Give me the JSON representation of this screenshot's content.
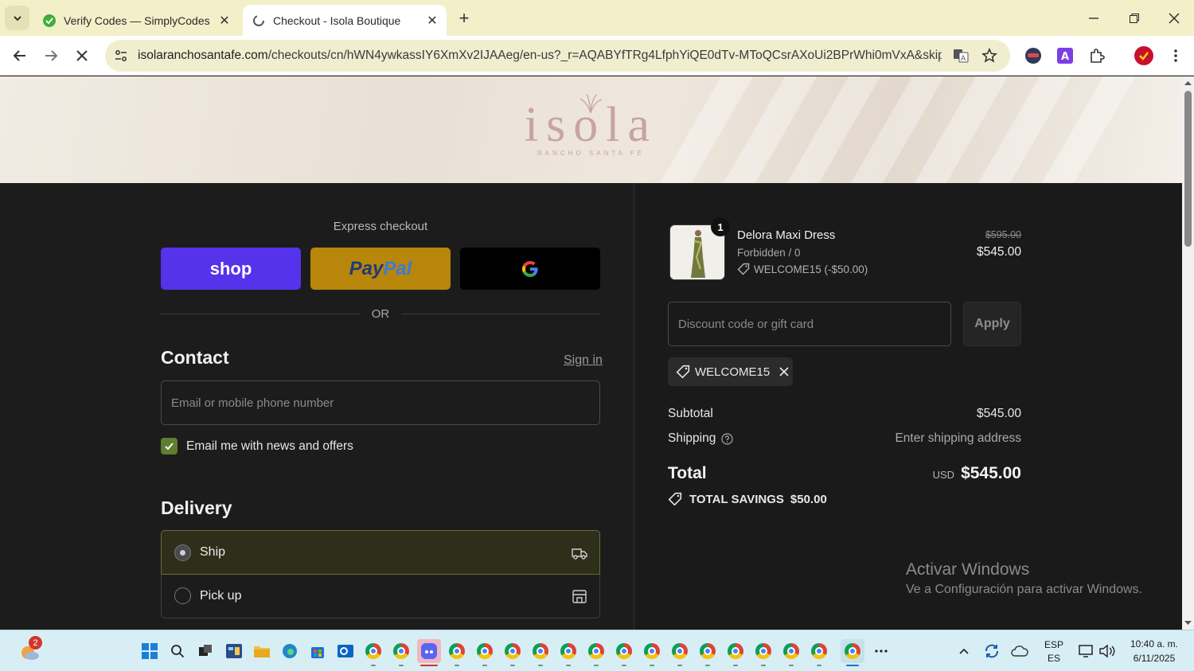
{
  "browser": {
    "tabs": [
      {
        "title": "Verify Codes — SimplyCodes",
        "active": false
      },
      {
        "title": "Checkout - Isola Boutique",
        "active": true
      }
    ],
    "url_host": "isolaranchosantafe.com",
    "url_path": "/checkouts/cn/hWN4ywkassIY6XmXv2IJAAeg/en-us?_r=AQABYfTRg4LfphYiQE0dTv-MToQCsrAXoUi2BPrWhi0mVxA&skip_sh..."
  },
  "banner": {
    "logo_word": "isola",
    "logo_sub": "RANCHO SANTA FE"
  },
  "checkout": {
    "express_title": "Express checkout",
    "shop_label": "shop",
    "paypal_pay": "Pay",
    "paypal_pal": "Pal",
    "or_label": "OR",
    "contact_heading": "Contact",
    "signin_label": "Sign in",
    "email_placeholder": "Email or mobile phone number",
    "news_label": "Email me with news and offers",
    "delivery_heading": "Delivery",
    "ship_label": "Ship",
    "pickup_label": "Pick up"
  },
  "summary": {
    "item": {
      "quantity": "1",
      "name": "Delora Maxi Dress",
      "variant": "Forbidden / 0",
      "discount": "WELCOME15 (-$50.00)",
      "old_price": "$595.00",
      "price": "$545.00"
    },
    "discount_placeholder": "Discount code or gift card",
    "apply_label": "Apply",
    "applied_code": "WELCOME15",
    "subtotal_label": "Subtotal",
    "subtotal_value": "$545.00",
    "shipping_label": "Shipping",
    "shipping_value": "Enter shipping address",
    "total_label": "Total",
    "total_currency": "USD",
    "total_value": "$545.00",
    "savings_label": "TOTAL SAVINGS",
    "savings_value": "$50.00"
  },
  "watermark": {
    "line1": "Activar Windows",
    "line2": "Ve a Configuración para activar Windows."
  },
  "taskbar": {
    "weather_badge": "2",
    "lang_top": "ESP",
    "lang_bottom": "ES",
    "time": "10:40 a. m.",
    "date": "6/11/2025"
  },
  "colors": {
    "shop": "#5433eb",
    "paypal": "#b8860b",
    "checkbox": "#5e7d2f",
    "logo": "#c7a4a3"
  }
}
